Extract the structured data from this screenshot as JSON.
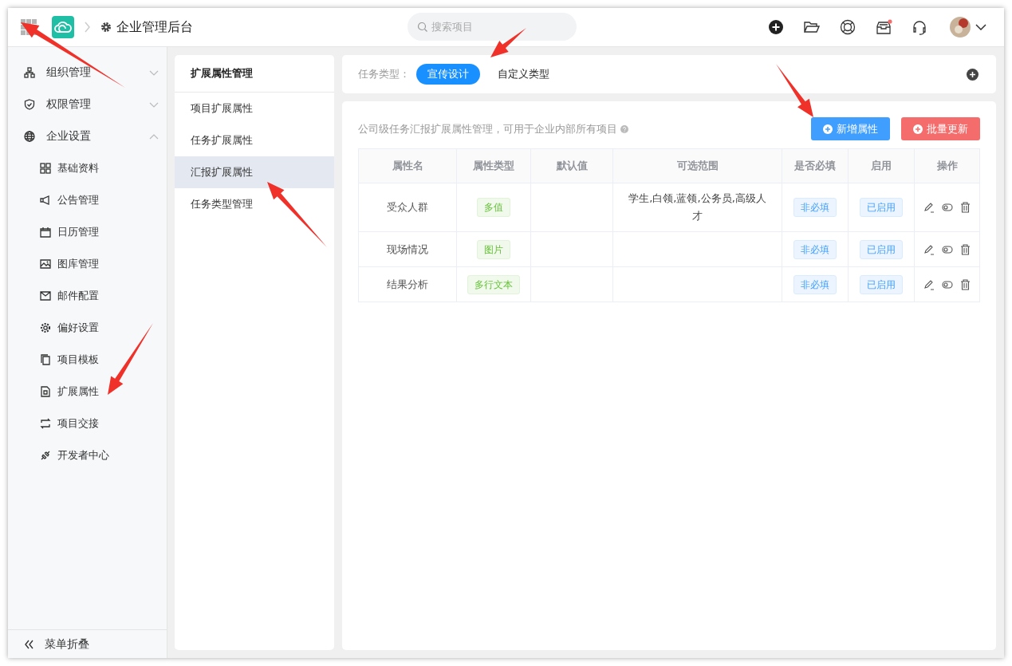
{
  "header": {
    "title": "企业管理后台",
    "search": {
      "placeholder": "搜索项目"
    },
    "inbox_unread": true
  },
  "sidebar": {
    "items": [
      {
        "label": "组织管理",
        "expanded": false
      },
      {
        "label": "权限管理",
        "expanded": false
      },
      {
        "label": "企业设置",
        "expanded": true,
        "children": [
          {
            "label": "基础资料"
          },
          {
            "label": "公告管理"
          },
          {
            "label": "日历管理"
          },
          {
            "label": "图库管理"
          },
          {
            "label": "邮件配置"
          },
          {
            "label": "偏好设置"
          },
          {
            "label": "项目模板"
          },
          {
            "label": "扩展属性"
          },
          {
            "label": "项目交接"
          },
          {
            "label": "开发者中心"
          }
        ]
      }
    ],
    "collapse_label": "菜单折叠"
  },
  "submenu": {
    "title": "扩展属性管理",
    "items": [
      {
        "label": "项目扩展属性",
        "selected": false
      },
      {
        "label": "任务扩展属性",
        "selected": false
      },
      {
        "label": "汇报扩展属性",
        "selected": true
      },
      {
        "label": "任务类型管理",
        "selected": false
      }
    ]
  },
  "task_types": {
    "label": "任务类型：",
    "tabs": [
      {
        "label": "宣传设计",
        "selected": true
      },
      {
        "label": "自定义类型",
        "selected": false
      }
    ]
  },
  "panel": {
    "description": "公司级任务汇报扩展属性管理，可用于企业内部所有项目",
    "buttons": [
      {
        "label": "新增属性",
        "kind": "primary"
      },
      {
        "label": "批量更新",
        "kind": "danger"
      }
    ]
  },
  "table": {
    "columns": [
      "属性名",
      "属性类型",
      "默认值",
      "可选范围",
      "是否必填",
      "启用",
      "操作"
    ],
    "rows": [
      {
        "name": "受众人群",
        "type": "多值",
        "range": "学生,白领,蓝领,公务员,高级人才",
        "required": "非必填",
        "status": "已启用"
      },
      {
        "name": "现场情况",
        "type": "图片",
        "required": "非必填",
        "status": "已启用"
      },
      {
        "name": "结果分析",
        "type": "多行文本",
        "required": "非必填",
        "status": "已启用"
      }
    ]
  }
}
